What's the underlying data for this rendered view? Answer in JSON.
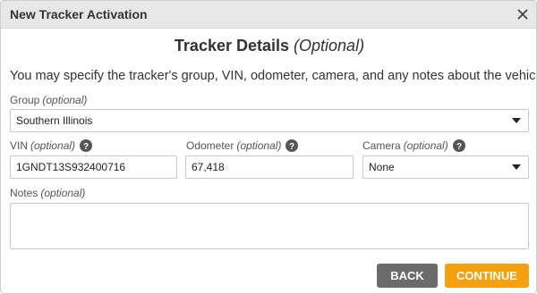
{
  "dialog": {
    "title": "New Tracker Activation",
    "heading_main": "Tracker Details",
    "heading_optional": "(Optional)",
    "description": "You may specify the tracker's group, VIN, odometer, camera, and any notes about the vehicle."
  },
  "fields": {
    "group": {
      "label": "Group",
      "optional": "(optional)",
      "value": "Southern Illinois"
    },
    "vin": {
      "label": "VIN",
      "optional": "(optional)",
      "value": "1GNDT13S932400716"
    },
    "odometer": {
      "label": "Odometer",
      "optional": "(optional)",
      "value": "67,418"
    },
    "camera": {
      "label": "Camera",
      "optional": "(optional)",
      "value": "None"
    },
    "notes": {
      "label": "Notes",
      "optional": "(optional)",
      "value": ""
    }
  },
  "buttons": {
    "back": "BACK",
    "continue": "CONTINUE"
  },
  "colors": {
    "continue": "#f5a00f",
    "back": "#6b6b6b",
    "titlebar": "#e7e7e7"
  },
  "icons": {
    "close": "close-icon",
    "help": "help-circle-icon",
    "dropdown": "caret-down-icon"
  }
}
